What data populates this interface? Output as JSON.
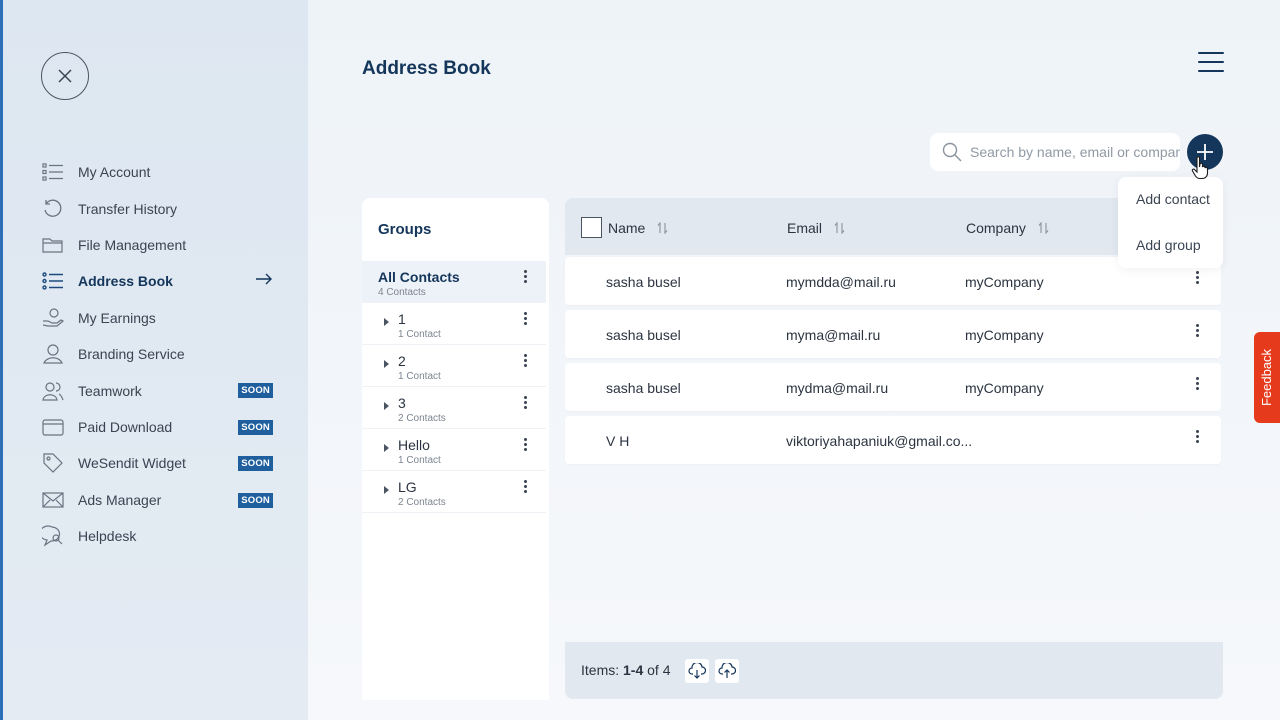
{
  "page": {
    "title": "Address Book"
  },
  "sidebar": {
    "items": [
      {
        "label": "My Account",
        "icon": "list-icon"
      },
      {
        "label": "Transfer History",
        "icon": "history-icon"
      },
      {
        "label": "File Management",
        "icon": "folder-icon"
      },
      {
        "label": "Address Book",
        "icon": "address-list-icon",
        "active": true
      },
      {
        "label": "My Earnings",
        "icon": "hand-coins-icon"
      },
      {
        "label": "Branding Service",
        "icon": "branding-icon"
      },
      {
        "label": "Teamwork",
        "icon": "team-icon",
        "badge": "SOON"
      },
      {
        "label": "Paid Download",
        "icon": "wallet-icon",
        "badge": "SOON"
      },
      {
        "label": "WeSendit Widget",
        "icon": "tag-icon",
        "badge": "SOON"
      },
      {
        "label": "Ads Manager",
        "icon": "mail-icon",
        "badge": "SOON"
      },
      {
        "label": "Helpdesk",
        "icon": "chat-search-icon"
      }
    ]
  },
  "search": {
    "placeholder": "Search by name, email or company",
    "value": ""
  },
  "add_menu": {
    "options": [
      "Add contact",
      "Add group"
    ]
  },
  "groups": {
    "title": "Groups",
    "items": [
      {
        "name": "All Contacts",
        "count": "4 Contacts",
        "active": true
      },
      {
        "name": "1",
        "count": "1 Contact"
      },
      {
        "name": "2",
        "count": "1 Contact"
      },
      {
        "name": "3",
        "count": "2 Contacts"
      },
      {
        "name": "Hello",
        "count": "1 Contact"
      },
      {
        "name": "LG",
        "count": "2 Contacts"
      }
    ]
  },
  "table": {
    "columns": [
      "Name",
      "Email",
      "Company"
    ],
    "rows": [
      {
        "name": "sasha busel",
        "email": "mymdda@mail.ru",
        "company": "myCompany"
      },
      {
        "name": "sasha busel",
        "email": "myma@mail.ru",
        "company": "myCompany"
      },
      {
        "name": "sasha busel",
        "email": "mydma@mail.ru",
        "company": "myCompany"
      },
      {
        "name": "V H",
        "email": "viktoriyahapaniuk@gmail.co...",
        "company": ""
      }
    ]
  },
  "footer": {
    "items_prefix": "Items:",
    "range": "1-4",
    "of_total": "of 4"
  },
  "feedback": {
    "label": "Feedback"
  },
  "colors": {
    "primary": "#14365a",
    "badge": "#1f5f9e",
    "feedback": "#e63a1d"
  }
}
